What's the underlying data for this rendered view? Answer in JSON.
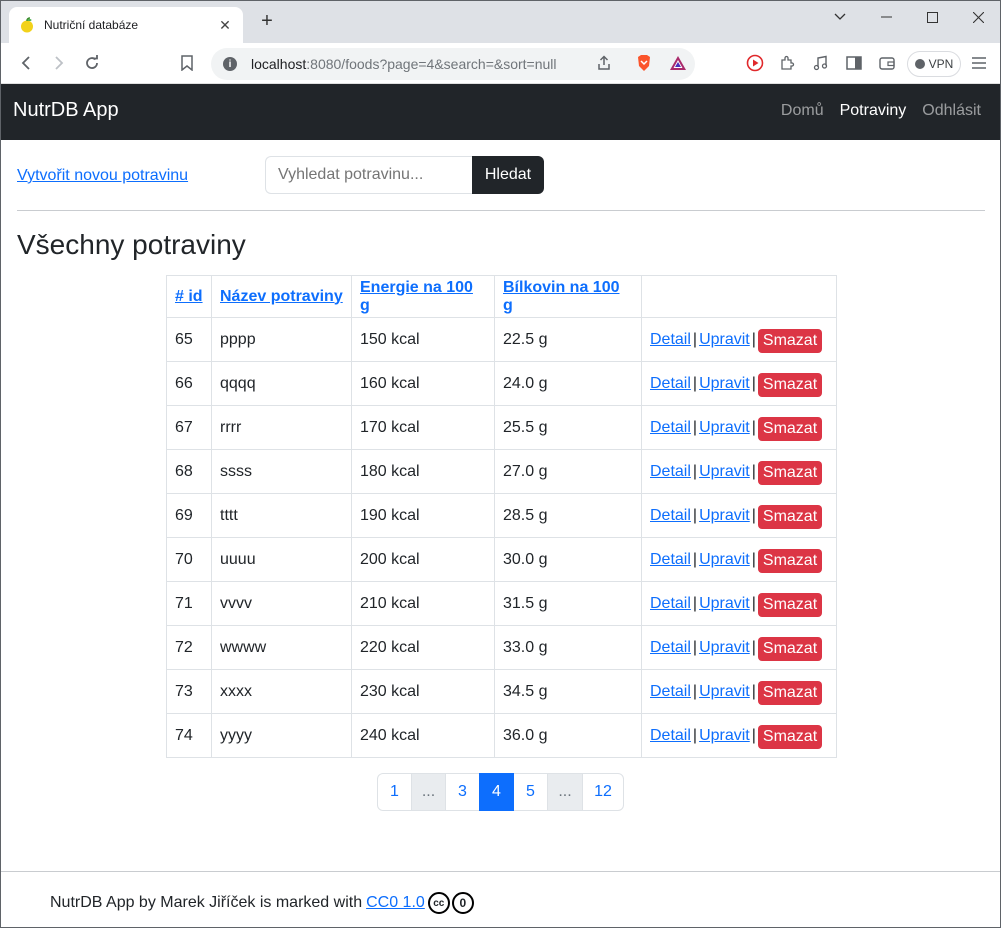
{
  "browser": {
    "tab_title": "Nutriční databáze",
    "url_host": "localhost",
    "url_path": ":8080/foods?page=4&search=&sort=null",
    "vpn_label": "VPN"
  },
  "navbar": {
    "brand": "NutrDB App",
    "links": [
      "Domů",
      "Potraviny",
      "Odhlásit"
    ],
    "active": "Potraviny"
  },
  "toolbar": {
    "create_link": "Vytvořit novou potravinu",
    "search_placeholder": "Vyhledat potravinu...",
    "search_button": "Hledat"
  },
  "page_title": "Všechny potraviny",
  "table": {
    "headers": [
      "# id",
      "Název potraviny",
      "Energie na 100 g",
      "Bílkovin na 100 g"
    ],
    "action_labels": {
      "detail": "Detail",
      "edit": "Upravit",
      "delete": "Smazat",
      "separator": "|"
    },
    "rows": [
      {
        "id": "65",
        "name": "pppp",
        "energy": "150 kcal",
        "protein": "22.5 g"
      },
      {
        "id": "66",
        "name": "qqqq",
        "energy": "160 kcal",
        "protein": "24.0 g"
      },
      {
        "id": "67",
        "name": "rrrr",
        "energy": "170 kcal",
        "protein": "25.5 g"
      },
      {
        "id": "68",
        "name": "ssss",
        "energy": "180 kcal",
        "protein": "27.0 g"
      },
      {
        "id": "69",
        "name": "tttt",
        "energy": "190 kcal",
        "protein": "28.5 g"
      },
      {
        "id": "70",
        "name": "uuuu",
        "energy": "200 kcal",
        "protein": "30.0 g"
      },
      {
        "id": "71",
        "name": "vvvv",
        "energy": "210 kcal",
        "protein": "31.5 g"
      },
      {
        "id": "72",
        "name": "wwww",
        "energy": "220 kcal",
        "protein": "33.0 g"
      },
      {
        "id": "73",
        "name": "xxxx",
        "energy": "230 kcal",
        "protein": "34.5 g"
      },
      {
        "id": "74",
        "name": "yyyy",
        "energy": "240 kcal",
        "protein": "36.0 g"
      }
    ]
  },
  "pagination": {
    "items": [
      "1",
      "...",
      "3",
      "4",
      "5",
      "...",
      "12"
    ],
    "active": "4"
  },
  "footer": {
    "text": "NutrDB App by Marek Jiříček is marked with",
    "link": "CC0 1.0",
    "cc_icon_label": "cc",
    "zero_icon_label": "0"
  },
  "colors": {
    "navbar_bg": "#212529",
    "link": "#0d6efd",
    "danger": "#dc3545",
    "active_page": "#0d6efd"
  }
}
